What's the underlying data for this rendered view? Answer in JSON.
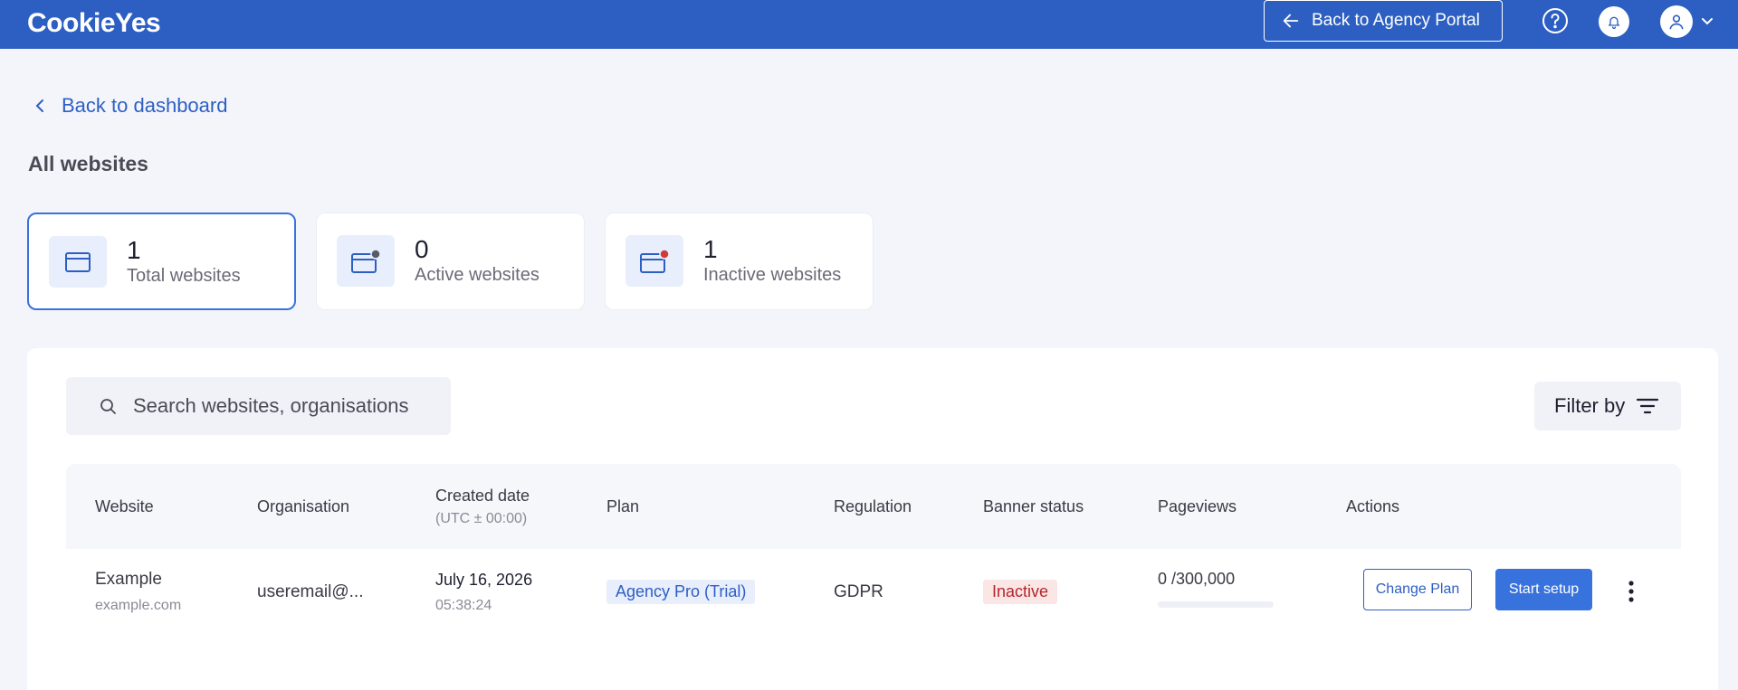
{
  "header": {
    "logo": "CookieYes",
    "back_portal_label": "Back to Agency Portal",
    "colors": {
      "bar": "#2d5fc3"
    }
  },
  "nav": {
    "back_label": "Back to dashboard"
  },
  "page_title": "All websites",
  "stats": [
    {
      "count": "1",
      "label": "Total websites",
      "icon": "browser-icon"
    },
    {
      "count": "0",
      "label": "Active websites",
      "icon": "browser-active-icon"
    },
    {
      "count": "1",
      "label": "Inactive websites",
      "icon": "browser-inactive-icon"
    }
  ],
  "search": {
    "placeholder": "Search websites, organisations"
  },
  "filter": {
    "label": "Filter by"
  },
  "table": {
    "columns": {
      "website": "Website",
      "organisation": "Organisation",
      "created": "Created date",
      "created_sub": "(UTC ± 00:00)",
      "plan": "Plan",
      "regulation": "Regulation",
      "banner_status": "Banner status",
      "pageviews": "Pageviews",
      "actions": "Actions"
    },
    "rows": [
      {
        "website_name": "Example",
        "website_domain": "example.com",
        "organisation": "useremail@...",
        "created_date": "July 16, 2026",
        "created_time": "05:38:24",
        "plan": "Agency Pro (Trial)",
        "regulation": "GDPR",
        "banner_status": "Inactive",
        "pageviews": "0 /300,000",
        "pageviews_fraction": 0,
        "change_plan_label": "Change Plan",
        "start_setup_label": "Start setup"
      }
    ]
  }
}
